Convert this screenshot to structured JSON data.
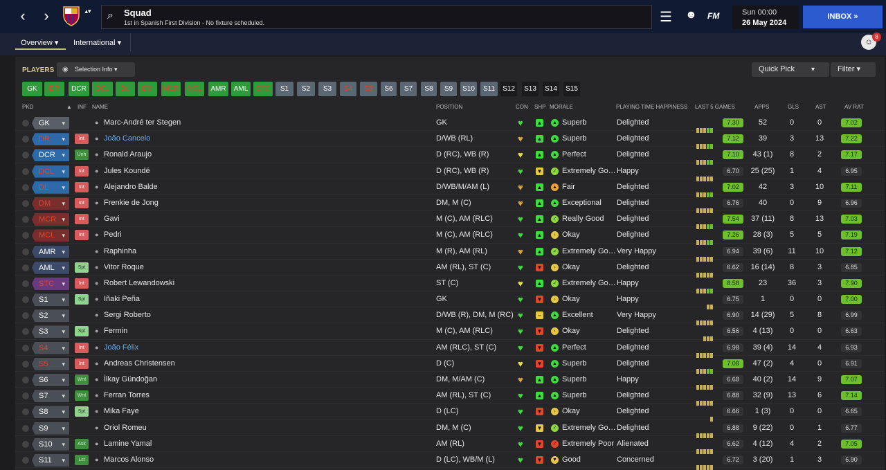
{
  "nav": {
    "back_icon": "‹",
    "forward_icon": "›",
    "crest_arrows": "▴▾"
  },
  "header": {
    "title": "Squad",
    "subtitle": "1st in Spanish First Division - No fixture scheduled.",
    "fm_logo": "FM",
    "time": "Sun 00:00",
    "date": "26 May 2024",
    "inbox": "INBOX »",
    "notification_count": "8"
  },
  "tabs": {
    "overview": "Overview ▾",
    "international": "International ▾"
  },
  "toolbar": {
    "players_label": "PLAYERS",
    "selection_info": "Selection Info ▾",
    "quick_pick": "Quick Pick",
    "filter": "Filter ▾"
  },
  "chips": [
    {
      "label": "GK",
      "style": "green"
    },
    {
      "label": "DR",
      "style": "greenr"
    },
    {
      "label": "DCR",
      "style": "green"
    },
    {
      "label": "DCL",
      "style": "greenr"
    },
    {
      "label": "DL",
      "style": "greenr"
    },
    {
      "label": "DM",
      "style": "greenr"
    },
    {
      "label": "MCR",
      "style": "greenr"
    },
    {
      "label": "MCL",
      "style": "greenr"
    },
    {
      "label": "AMR",
      "style": "green"
    },
    {
      "label": "AML",
      "style": "green"
    },
    {
      "label": "STC",
      "style": "greenr"
    },
    {
      "label": "S1",
      "style": "grey"
    },
    {
      "label": "S2",
      "style": "grey"
    },
    {
      "label": "S3",
      "style": "grey"
    },
    {
      "label": "S4",
      "style": "greyr"
    },
    {
      "label": "S5",
      "style": "greyr"
    },
    {
      "label": "S6",
      "style": "grey"
    },
    {
      "label": "S7",
      "style": "grey"
    },
    {
      "label": "S8",
      "style": "grey"
    },
    {
      "label": "S9",
      "style": "grey"
    },
    {
      "label": "S10",
      "style": "grey"
    },
    {
      "label": "S11",
      "style": "grey"
    },
    {
      "label": "S12",
      "style": "dark"
    },
    {
      "label": "S13",
      "style": "dark"
    },
    {
      "label": "S14",
      "style": "dark"
    },
    {
      "label": "S15",
      "style": "dark"
    }
  ],
  "columns": {
    "pkd": "PKD",
    "inf": "INF",
    "name": "NAME",
    "position": "POSITION",
    "con": "CON",
    "shp": "SHP",
    "morale": "MORALE",
    "pth": "PLAYING TIME HAPPINESS",
    "last5": "LAST 5 GAMES",
    "apps": "APPS",
    "gls": "GLS",
    "ast": "AST",
    "avrat": "AV RAT"
  },
  "colors": {
    "accent_gold": "#d8c48c",
    "inbox_blue": "#2d5bcf",
    "pos_gk": "#5a5e66",
    "pos_def": "#2e6aa8",
    "pos_mid": "#7a2d2d",
    "pos_att": "#3a4a68",
    "pos_st": "#6a3a80",
    "pos_sub": "#4a4e56",
    "form_green": "#6dbf2c"
  },
  "players": [
    {
      "pkd": "GK",
      "pkd_color": "#5a5e66",
      "pkd_text": "#fff",
      "inf": "",
      "name": "Marc-André ter Stegen",
      "link": false,
      "position": "GK",
      "con": "#3fdb3f",
      "shp": "#3fdb3f",
      "shp_icon": "▲",
      "morale_color": "#3fdb3f",
      "morale_icon": "▲",
      "morale": "Superb",
      "pth": "Delighted",
      "bars": 5,
      "form": "7.30",
      "form_hi": true,
      "apps": "52",
      "gls": "0",
      "ast": "0",
      "avrat": "7.02",
      "avrat_hi": true
    },
    {
      "pkd": "DR",
      "pkd_color": "#2e6aa8",
      "pkd_text": "#e0452d",
      "inf": "Int",
      "name": "João Cancelo",
      "link": true,
      "position": "D/WB (RL)",
      "con": "#d9a441",
      "shp": "#3fdb3f",
      "shp_icon": "▲",
      "morale_color": "#3fdb3f",
      "morale_icon": "▲",
      "morale": "Superb",
      "pth": "Delighted",
      "bars": 5,
      "form": "7.12",
      "form_hi": true,
      "apps": "39",
      "gls": "3",
      "ast": "13",
      "avrat": "7.22",
      "avrat_hi": true
    },
    {
      "pkd": "DCR",
      "pkd_color": "#2e6aa8",
      "pkd_text": "#fff",
      "inf": "Unh",
      "name": "Ronald Araujo",
      "link": false,
      "position": "D (RC), WB (R)",
      "con": "#e4e04a",
      "shp": "#3fdb3f",
      "shp_icon": "▲",
      "morale_color": "#3fdb3f",
      "morale_icon": "▲",
      "morale": "Perfect",
      "pth": "Delighted",
      "bars": 5,
      "form": "7.10",
      "form_hi": true,
      "apps": "43 (1)",
      "gls": "8",
      "ast": "2",
      "avrat": "7.17",
      "avrat_hi": true
    },
    {
      "pkd": "DCL",
      "pkd_color": "#2e6aa8",
      "pkd_text": "#e0452d",
      "inf": "Int",
      "name": "Jules Koundé",
      "link": false,
      "position": "D (RC), WB (R)",
      "con": "#3fdb3f",
      "shp": "#e4c64a",
      "shp_icon": "▼",
      "morale_color": "#8fd63f",
      "morale_icon": "✓",
      "morale": "Extremely Go…",
      "pth": "Happy",
      "bars": 5,
      "form": "6.70",
      "form_hi": false,
      "apps": "25 (25)",
      "gls": "1",
      "ast": "4",
      "avrat": "6.95",
      "avrat_hi": false
    },
    {
      "pkd": "DL",
      "pkd_color": "#2e6aa8",
      "pkd_text": "#e0452d",
      "inf": "Int",
      "name": "Alejandro Balde",
      "link": false,
      "position": "D/WB/M/AM (L)",
      "con": "#d9a441",
      "shp": "#3fdb3f",
      "shp_icon": "▲",
      "morale_color": "#f0a23a",
      "morale_icon": "▲",
      "morale": "Fair",
      "pth": "Delighted",
      "bars": 5,
      "form": "7.02",
      "form_hi": true,
      "apps": "42",
      "gls": "3",
      "ast": "10",
      "avrat": "7.11",
      "avrat_hi": true
    },
    {
      "pkd": "DM",
      "pkd_color": "#7a2d2d",
      "pkd_text": "#e0452d",
      "inf": "Int",
      "name": "Frenkie de Jong",
      "link": false,
      "position": "DM, M (C)",
      "con": "#d9a441",
      "shp": "#3fdb3f",
      "shp_icon": "▲",
      "morale_color": "#3fdb3f",
      "morale_icon": "▲",
      "morale": "Exceptional",
      "pth": "Delighted",
      "bars": 5,
      "form": "6.76",
      "form_hi": false,
      "apps": "40",
      "gls": "0",
      "ast": "9",
      "avrat": "6.96",
      "avrat_hi": false
    },
    {
      "pkd": "MCR",
      "pkd_color": "#7a2d2d",
      "pkd_text": "#e0452d",
      "inf": "Int",
      "name": "Gavi",
      "link": false,
      "position": "M (C), AM (RLC)",
      "con": "#3fdb3f",
      "shp": "#3fdb3f",
      "shp_icon": "▲",
      "morale_color": "#8fd63f",
      "morale_icon": "✓",
      "morale": "Really Good",
      "pth": "Delighted",
      "bars": 5,
      "form": "7.54",
      "form_hi": true,
      "apps": "37 (11)",
      "gls": "8",
      "ast": "13",
      "avrat": "7.03",
      "avrat_hi": true
    },
    {
      "pkd": "MCL",
      "pkd_color": "#7a2d2d",
      "pkd_text": "#e0452d",
      "inf": "Int",
      "name": "Pedri",
      "link": false,
      "position": "M (C), AM (RLC)",
      "con": "#3fdb3f",
      "shp": "#3fdb3f",
      "shp_icon": "▲",
      "morale_color": "#e4c64a",
      "morale_icon": "›",
      "morale": "Okay",
      "pth": "Delighted",
      "bars": 5,
      "form": "7.26",
      "form_hi": true,
      "apps": "28 (3)",
      "gls": "5",
      "ast": "5",
      "avrat": "7.19",
      "avrat_hi": true
    },
    {
      "pkd": "AMR",
      "pkd_color": "#3a4a68",
      "pkd_text": "#fff",
      "inf": "",
      "name": "Raphinha",
      "link": false,
      "position": "M (R), AM (RL)",
      "con": "#d9a441",
      "shp": "#3fdb3f",
      "shp_icon": "▲",
      "morale_color": "#8fd63f",
      "morale_icon": "✓",
      "morale": "Extremely Go…",
      "pth": "Very Happy",
      "bars": 5,
      "form": "6.94",
      "form_hi": false,
      "apps": "39 (6)",
      "gls": "11",
      "ast": "10",
      "avrat": "7.12",
      "avrat_hi": true
    },
    {
      "pkd": "AML",
      "pkd_color": "#3a4a68",
      "pkd_text": "#fff",
      "inf": "Spt",
      "name": "Vitor Roque",
      "link": false,
      "position": "AM (RL), ST (C)",
      "con": "#3fdb3f",
      "shp": "#e0452d",
      "shp_icon": "▼",
      "morale_color": "#e4c64a",
      "morale_icon": "›",
      "morale": "Okay",
      "pth": "Delighted",
      "bars": 5,
      "form": "6.62",
      "form_hi": false,
      "apps": "16 (14)",
      "gls": "8",
      "ast": "3",
      "avrat": "6.85",
      "avrat_hi": false
    },
    {
      "pkd": "STC",
      "pkd_color": "#6a3a80",
      "pkd_text": "#e0452d",
      "inf": "Int",
      "name": "Robert Lewandowski",
      "link": false,
      "position": "ST (C)",
      "con": "#e4e04a",
      "shp": "#3fdb3f",
      "shp_icon": "▲",
      "morale_color": "#8fd63f",
      "morale_icon": "✓",
      "morale": "Extremely Go…",
      "pth": "Happy",
      "bars": 5,
      "form": "8.58",
      "form_hi": true,
      "apps": "23",
      "gls": "36",
      "ast": "3",
      "avrat": "7.90",
      "avrat_hi": true
    },
    {
      "pkd": "S1",
      "pkd_color": "#4a4e56",
      "pkd_text": "#fff",
      "inf": "Spt",
      "name": "Iñaki Peña",
      "link": false,
      "position": "GK",
      "con": "#3fdb3f",
      "shp": "#e0452d",
      "shp_icon": "▼",
      "morale_color": "#e4c64a",
      "morale_icon": "›",
      "morale": "Okay",
      "pth": "Happy",
      "bars": 2,
      "form": "6.75",
      "form_hi": false,
      "apps": "1",
      "gls": "0",
      "ast": "0",
      "avrat": "7.00",
      "avrat_hi": true
    },
    {
      "pkd": "S2",
      "pkd_color": "#4a4e56",
      "pkd_text": "#fff",
      "inf": "",
      "name": "Sergi Roberto",
      "link": false,
      "position": "D/WB (R), DM, M (RC)",
      "con": "#3fdb3f",
      "shp": "#e4c64a",
      "shp_icon": "–",
      "morale_color": "#3fdb3f",
      "morale_icon": "▲",
      "morale": "Excellent",
      "pth": "Very Happy",
      "bars": 5,
      "form": "6.90",
      "form_hi": false,
      "apps": "14 (29)",
      "gls": "5",
      "ast": "8",
      "avrat": "6.99",
      "avrat_hi": false
    },
    {
      "pkd": "S3",
      "pkd_color": "#4a4e56",
      "pkd_text": "#fff",
      "inf": "Spt",
      "name": "Fermin",
      "link": false,
      "position": "M (C), AM (RLC)",
      "con": "#3fdb3f",
      "shp": "#e0452d",
      "shp_icon": "▼",
      "morale_color": "#e4c64a",
      "morale_icon": "›",
      "morale": "Okay",
      "pth": "Delighted",
      "bars": 3,
      "form": "6.56",
      "form_hi": false,
      "apps": "4 (13)",
      "gls": "0",
      "ast": "0",
      "avrat": "6.63",
      "avrat_hi": false
    },
    {
      "pkd": "S4",
      "pkd_color": "#4a4e56",
      "pkd_text": "#e0452d",
      "inf": "Int",
      "name": "João Félix",
      "link": true,
      "position": "AM (RLC), ST (C)",
      "con": "#3fdb3f",
      "shp": "#e0452d",
      "shp_icon": "▼",
      "morale_color": "#3fdb3f",
      "morale_icon": "▲",
      "morale": "Perfect",
      "pth": "Delighted",
      "bars": 5,
      "form": "6.98",
      "form_hi": false,
      "apps": "39 (4)",
      "gls": "14",
      "ast": "4",
      "avrat": "6.93",
      "avrat_hi": false
    },
    {
      "pkd": "S5",
      "pkd_color": "#4a4e56",
      "pkd_text": "#e0452d",
      "inf": "Int",
      "name": "Andreas Christensen",
      "link": false,
      "position": "D (C)",
      "con": "#e4e04a",
      "shp": "#e0452d",
      "shp_icon": "▼",
      "morale_color": "#3fdb3f",
      "morale_icon": "▲",
      "morale": "Superb",
      "pth": "Delighted",
      "bars": 5,
      "form": "7.08",
      "form_hi": true,
      "apps": "47 (2)",
      "gls": "4",
      "ast": "0",
      "avrat": "6.91",
      "avrat_hi": false
    },
    {
      "pkd": "S6",
      "pkd_color": "#4a4e56",
      "pkd_text": "#fff",
      "inf": "Wnt",
      "name": "İlkay Gündoğan",
      "link": false,
      "position": "DM, M/AM (C)",
      "con": "#d9a441",
      "shp": "#3fdb3f",
      "shp_icon": "▲",
      "morale_color": "#3fdb3f",
      "morale_icon": "▲",
      "morale": "Superb",
      "pth": "Happy",
      "bars": 5,
      "form": "6.68",
      "form_hi": false,
      "apps": "40 (2)",
      "gls": "14",
      "ast": "9",
      "avrat": "7.07",
      "avrat_hi": true
    },
    {
      "pkd": "S7",
      "pkd_color": "#4a4e56",
      "pkd_text": "#fff",
      "inf": "Wnt",
      "name": "Ferran Torres",
      "link": false,
      "position": "AM (RL), ST (C)",
      "con": "#3fdb3f",
      "shp": "#3fdb3f",
      "shp_icon": "▲",
      "morale_color": "#3fdb3f",
      "morale_icon": "▲",
      "morale": "Superb",
      "pth": "Delighted",
      "bars": 5,
      "form": "6.88",
      "form_hi": false,
      "apps": "32 (9)",
      "gls": "13",
      "ast": "6",
      "avrat": "7.14",
      "avrat_hi": true
    },
    {
      "pkd": "S8",
      "pkd_color": "#4a4e56",
      "pkd_text": "#fff",
      "inf": "Spt",
      "name": "Mika Faye",
      "link": false,
      "position": "D (LC)",
      "con": "#3fdb3f",
      "shp": "#e0452d",
      "shp_icon": "▼",
      "morale_color": "#e4c64a",
      "morale_icon": "›",
      "morale": "Okay",
      "pth": "Delighted",
      "bars": 1,
      "form": "6.66",
      "form_hi": false,
      "apps": "1 (3)",
      "gls": "0",
      "ast": "0",
      "avrat": "6.65",
      "avrat_hi": false
    },
    {
      "pkd": "S9",
      "pkd_color": "#4a4e56",
      "pkd_text": "#fff",
      "inf": "",
      "name": "Oriol Romeu",
      "link": false,
      "position": "DM, M (C)",
      "con": "#3fdb3f",
      "shp": "#e4c64a",
      "shp_icon": "▼",
      "morale_color": "#8fd63f",
      "morale_icon": "✓",
      "morale": "Extremely Go…",
      "pth": "Delighted",
      "bars": 5,
      "form": "6.88",
      "form_hi": false,
      "apps": "9 (22)",
      "gls": "0",
      "ast": "1",
      "avrat": "6.77",
      "avrat_hi": false
    },
    {
      "pkd": "S10",
      "pkd_color": "#4a4e56",
      "pkd_text": "#fff",
      "inf": "Ask",
      "name": "Lamine Yamal",
      "link": false,
      "position": "AM (RL)",
      "con": "#3fdb3f",
      "shp": "#e0452d",
      "shp_icon": "▼",
      "morale_color": "#e0452d",
      "morale_icon": "✓",
      "morale": "Extremely Poor",
      "pth": "Alienated",
      "bars": 5,
      "form": "6.62",
      "form_hi": false,
      "apps": "4 (12)",
      "gls": "4",
      "ast": "2",
      "avrat": "7.05",
      "avrat_hi": true
    },
    {
      "pkd": "S11",
      "pkd_color": "#4a4e56",
      "pkd_text": "#fff",
      "inf": "Lst",
      "name": "Marcos Alonso",
      "link": false,
      "position": "D (LC), WB/M (L)",
      "con": "#3fdb3f",
      "shp": "#e0452d",
      "shp_icon": "▼",
      "morale_color": "#e4c64a",
      "morale_icon": "▼",
      "morale": "Good",
      "pth": "Concerned",
      "bars": 5,
      "form": "6.72",
      "form_hi": false,
      "apps": "3 (20)",
      "gls": "1",
      "ast": "3",
      "avrat": "6.90",
      "avrat_hi": false
    }
  ]
}
